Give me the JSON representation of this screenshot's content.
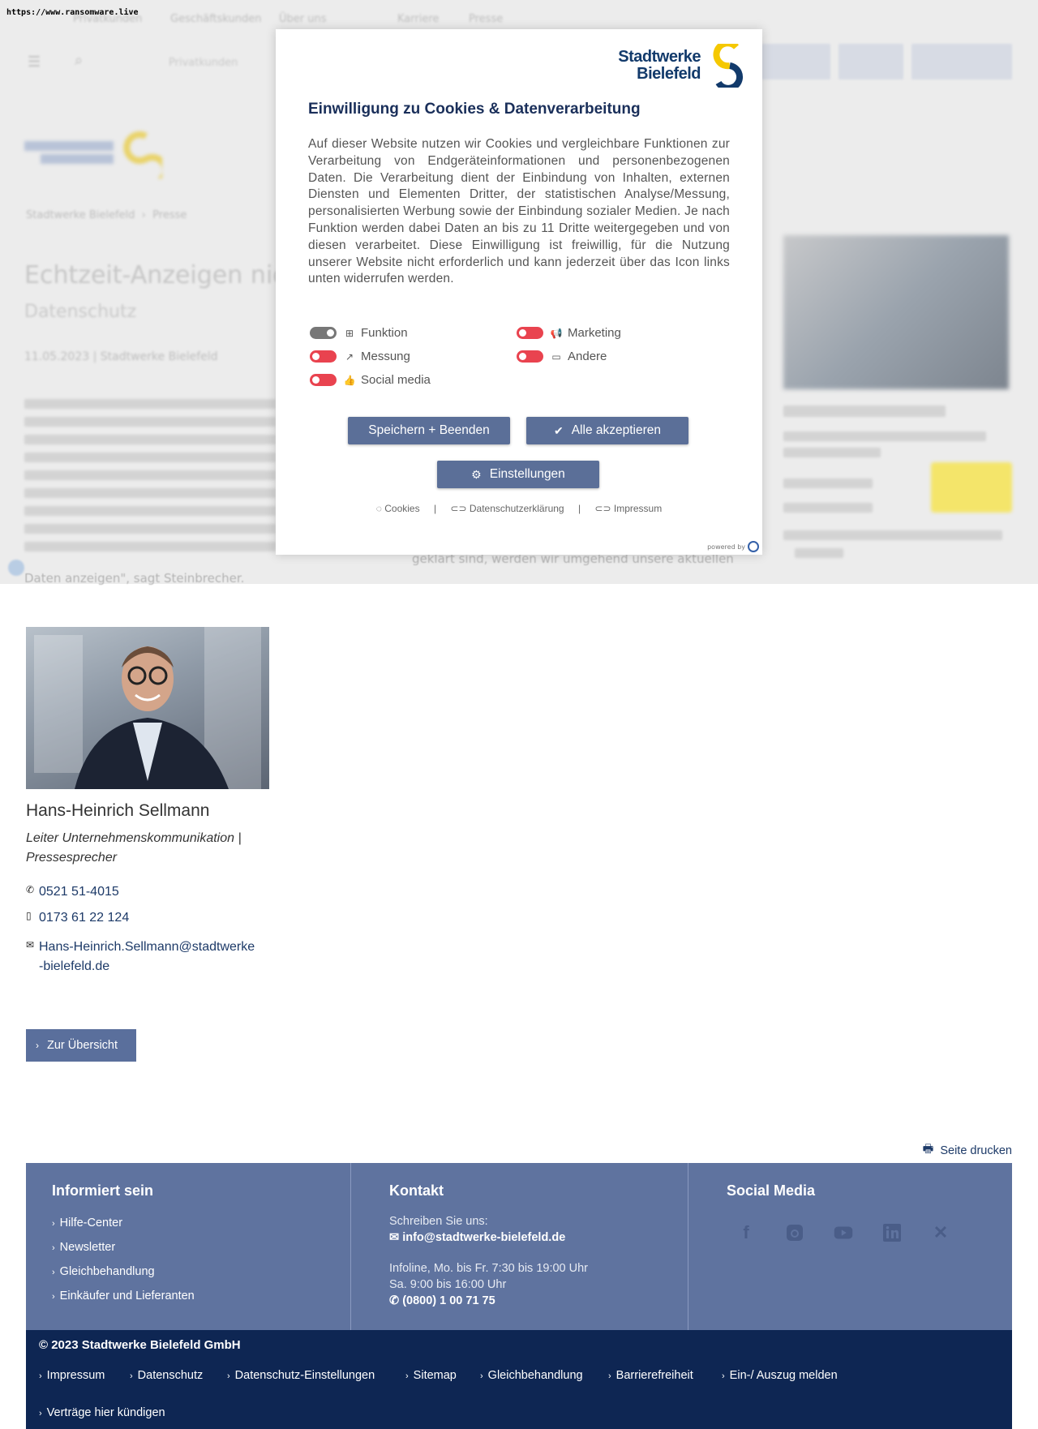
{
  "browser": {
    "url": "https://www.ransomware.live"
  },
  "background": {
    "nav_items": [
      "Privatkunden",
      "Geschäftskunden",
      "Über uns",
      "Karriere",
      "Presse"
    ],
    "breadcrumb": [
      "Stadtwerke Bielefeld",
      "Presse"
    ],
    "headline": "Echtzeit-Anzeigen nicht...",
    "subline": "Datenschutz",
    "dateline": "11.05.2023 | Stadtwerke Bielefeld",
    "tail_text": "Daten anzeigen\", sagt Steinbrecher.",
    "tail_text_right": "geklärt sind, werden wir umgehend unsere aktuellen"
  },
  "cookie_modal": {
    "logo_line1": "Stadtwerke",
    "logo_line2": "Bielefeld",
    "title": "Einwilligung zu Cookies & Datenverarbeitung",
    "intro": "Auf dieser Website nutzen wir Cookies und vergleichbare Funktionen zur Verarbeitung von Endgeräteinformationen und personenbezogenen Daten. Die Verarbeitung dient der Einbindung von Inhalten, externen Diensten und Elementen Dritter, der statistischen Analyse/Messung, personalisierten Werbung sowie der Einbindung sozialer Medien. Je nach Funktion werden dabei Daten an bis zu 11 Dritte weitergegeben und von diesen verarbeitet. Diese Einwilligung ist freiwillig, für die Nutzung unserer Website nicht erforderlich und kann jederzeit über das Icon links unten widerrufen werden.",
    "toggles": [
      {
        "label": "Funktion",
        "icon": "puzzle-icon",
        "state": "on-locked"
      },
      {
        "label": "Marketing",
        "icon": "megaphone-icon",
        "state": "off"
      },
      {
        "label": "Messung",
        "icon": "chart-line-icon",
        "state": "off"
      },
      {
        "label": "Andere",
        "icon": "comments-icon",
        "state": "off"
      },
      {
        "label": "Social media",
        "icon": "thumbs-up-icon",
        "state": "off"
      }
    ],
    "btn_save": "Speichern + Beenden",
    "btn_accept": "Alle akzeptieren",
    "btn_settings": "Einstellungen",
    "links": [
      "Cookies",
      "Datenschutzerklärung",
      "Impressum"
    ],
    "powered_by": "powered by"
  },
  "contact_card": {
    "name": "Hans-Heinrich Sellmann",
    "role": "Leiter Unternehmenskommunikation | Pressesprecher",
    "phone": "0521 51-4015",
    "mobile": "0173 61 22 124",
    "email": "Hans-Heinrich.Sellmann@stadtwerke-bielefeld.de"
  },
  "overview_button": "Zur Übersicht",
  "print_label": "Seite drucken",
  "footer": {
    "col1_title": "Informiert sein",
    "col1_links": [
      "Hilfe-Center",
      "Newsletter",
      "Gleichbehandlung",
      "Einkäufer und Lieferanten"
    ],
    "col2_title": "Kontakt",
    "write_us": "Schreiben Sie uns:",
    "email": "info@stadtwerke-bielefeld.de",
    "infoline1": "Infoline, Mo. bis Fr. 7:30 bis 19:00 Uhr",
    "infoline2": "Sa. 9:00 bis 16:00 Uhr",
    "phone": "(0800) 1 00 71 75",
    "col3_title": "Social Media",
    "social": [
      "facebook-icon",
      "instagram-icon",
      "youtube-icon",
      "linkedin-icon",
      "xing-icon"
    ]
  },
  "footer_bottom": {
    "copyright": "© 2023 Stadtwerke Bielefeld GmbH",
    "links": [
      "Impressum",
      "Datenschutz",
      "Datenschutz-Einstellungen",
      "Sitemap",
      "Gleichbehandlung",
      "Barrierefreiheit",
      "Ein-/ Auszug melden"
    ],
    "link2": "Verträge hier kündigen"
  },
  "colors": {
    "brand_blue": "#0e2653",
    "footer_blue": "#5f739f",
    "button_blue": "#5a6f9c",
    "toggle_red": "#e9434f"
  }
}
